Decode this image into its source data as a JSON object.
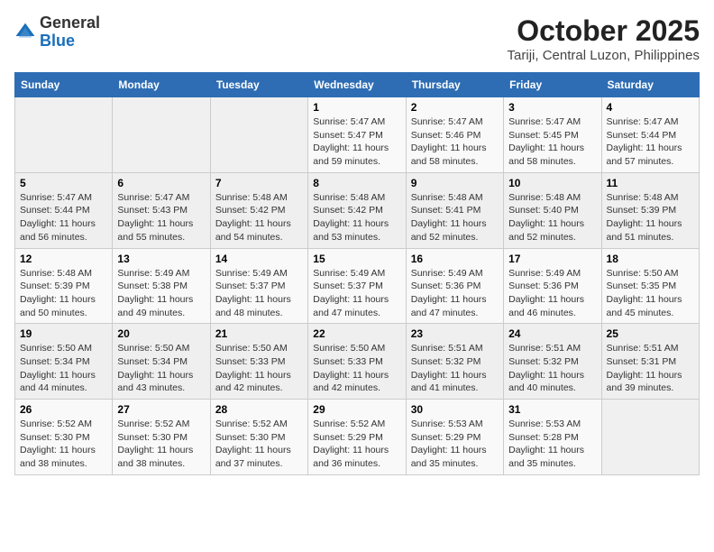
{
  "header": {
    "logo_line1": "General",
    "logo_line2": "Blue",
    "month": "October 2025",
    "location": "Tariji, Central Luzon, Philippines"
  },
  "days_of_week": [
    "Sunday",
    "Monday",
    "Tuesday",
    "Wednesday",
    "Thursday",
    "Friday",
    "Saturday"
  ],
  "weeks": [
    [
      {
        "num": "",
        "info": ""
      },
      {
        "num": "",
        "info": ""
      },
      {
        "num": "",
        "info": ""
      },
      {
        "num": "1",
        "info": "Sunrise: 5:47 AM\nSunset: 5:47 PM\nDaylight: 11 hours\nand 59 minutes."
      },
      {
        "num": "2",
        "info": "Sunrise: 5:47 AM\nSunset: 5:46 PM\nDaylight: 11 hours\nand 58 minutes."
      },
      {
        "num": "3",
        "info": "Sunrise: 5:47 AM\nSunset: 5:45 PM\nDaylight: 11 hours\nand 58 minutes."
      },
      {
        "num": "4",
        "info": "Sunrise: 5:47 AM\nSunset: 5:44 PM\nDaylight: 11 hours\nand 57 minutes."
      }
    ],
    [
      {
        "num": "5",
        "info": "Sunrise: 5:47 AM\nSunset: 5:44 PM\nDaylight: 11 hours\nand 56 minutes."
      },
      {
        "num": "6",
        "info": "Sunrise: 5:47 AM\nSunset: 5:43 PM\nDaylight: 11 hours\nand 55 minutes."
      },
      {
        "num": "7",
        "info": "Sunrise: 5:48 AM\nSunset: 5:42 PM\nDaylight: 11 hours\nand 54 minutes."
      },
      {
        "num": "8",
        "info": "Sunrise: 5:48 AM\nSunset: 5:42 PM\nDaylight: 11 hours\nand 53 minutes."
      },
      {
        "num": "9",
        "info": "Sunrise: 5:48 AM\nSunset: 5:41 PM\nDaylight: 11 hours\nand 52 minutes."
      },
      {
        "num": "10",
        "info": "Sunrise: 5:48 AM\nSunset: 5:40 PM\nDaylight: 11 hours\nand 52 minutes."
      },
      {
        "num": "11",
        "info": "Sunrise: 5:48 AM\nSunset: 5:39 PM\nDaylight: 11 hours\nand 51 minutes."
      }
    ],
    [
      {
        "num": "12",
        "info": "Sunrise: 5:48 AM\nSunset: 5:39 PM\nDaylight: 11 hours\nand 50 minutes."
      },
      {
        "num": "13",
        "info": "Sunrise: 5:49 AM\nSunset: 5:38 PM\nDaylight: 11 hours\nand 49 minutes."
      },
      {
        "num": "14",
        "info": "Sunrise: 5:49 AM\nSunset: 5:37 PM\nDaylight: 11 hours\nand 48 minutes."
      },
      {
        "num": "15",
        "info": "Sunrise: 5:49 AM\nSunset: 5:37 PM\nDaylight: 11 hours\nand 47 minutes."
      },
      {
        "num": "16",
        "info": "Sunrise: 5:49 AM\nSunset: 5:36 PM\nDaylight: 11 hours\nand 47 minutes."
      },
      {
        "num": "17",
        "info": "Sunrise: 5:49 AM\nSunset: 5:36 PM\nDaylight: 11 hours\nand 46 minutes."
      },
      {
        "num": "18",
        "info": "Sunrise: 5:50 AM\nSunset: 5:35 PM\nDaylight: 11 hours\nand 45 minutes."
      }
    ],
    [
      {
        "num": "19",
        "info": "Sunrise: 5:50 AM\nSunset: 5:34 PM\nDaylight: 11 hours\nand 44 minutes."
      },
      {
        "num": "20",
        "info": "Sunrise: 5:50 AM\nSunset: 5:34 PM\nDaylight: 11 hours\nand 43 minutes."
      },
      {
        "num": "21",
        "info": "Sunrise: 5:50 AM\nSunset: 5:33 PM\nDaylight: 11 hours\nand 42 minutes."
      },
      {
        "num": "22",
        "info": "Sunrise: 5:50 AM\nSunset: 5:33 PM\nDaylight: 11 hours\nand 42 minutes."
      },
      {
        "num": "23",
        "info": "Sunrise: 5:51 AM\nSunset: 5:32 PM\nDaylight: 11 hours\nand 41 minutes."
      },
      {
        "num": "24",
        "info": "Sunrise: 5:51 AM\nSunset: 5:32 PM\nDaylight: 11 hours\nand 40 minutes."
      },
      {
        "num": "25",
        "info": "Sunrise: 5:51 AM\nSunset: 5:31 PM\nDaylight: 11 hours\nand 39 minutes."
      }
    ],
    [
      {
        "num": "26",
        "info": "Sunrise: 5:52 AM\nSunset: 5:30 PM\nDaylight: 11 hours\nand 38 minutes."
      },
      {
        "num": "27",
        "info": "Sunrise: 5:52 AM\nSunset: 5:30 PM\nDaylight: 11 hours\nand 38 minutes."
      },
      {
        "num": "28",
        "info": "Sunrise: 5:52 AM\nSunset: 5:30 PM\nDaylight: 11 hours\nand 37 minutes."
      },
      {
        "num": "29",
        "info": "Sunrise: 5:52 AM\nSunset: 5:29 PM\nDaylight: 11 hours\nand 36 minutes."
      },
      {
        "num": "30",
        "info": "Sunrise: 5:53 AM\nSunset: 5:29 PM\nDaylight: 11 hours\nand 35 minutes."
      },
      {
        "num": "31",
        "info": "Sunrise: 5:53 AM\nSunset: 5:28 PM\nDaylight: 11 hours\nand 35 minutes."
      },
      {
        "num": "",
        "info": ""
      }
    ]
  ]
}
